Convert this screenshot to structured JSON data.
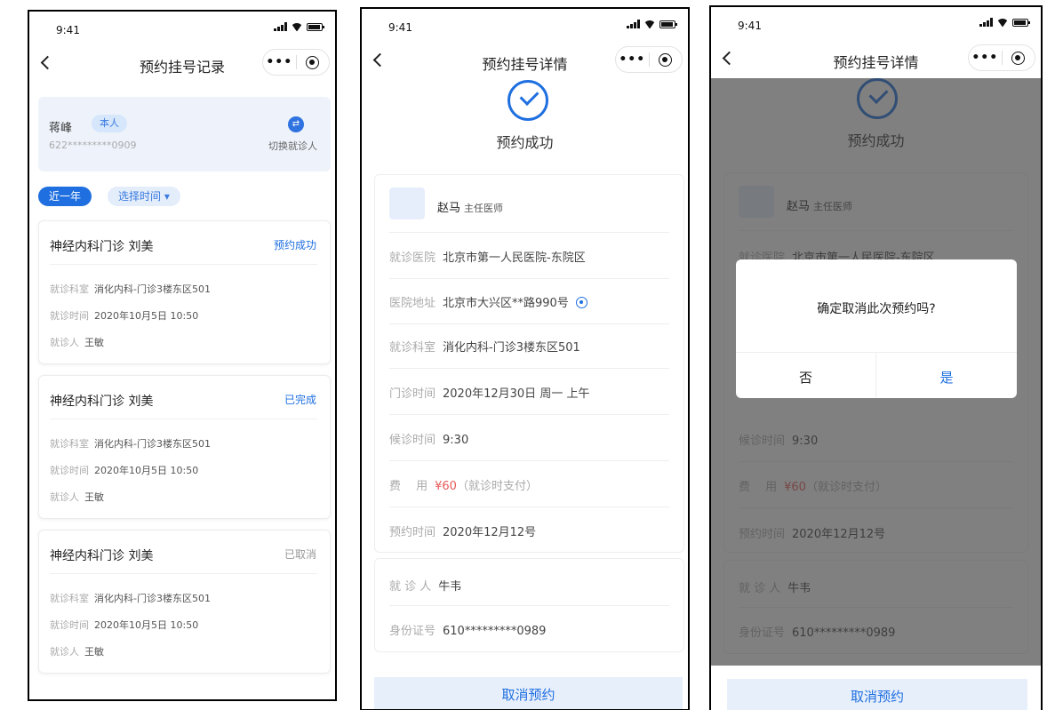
{
  "status_time": "9:41",
  "colors": {
    "primary": "#1f6fe0",
    "price": "#e85b5b",
    "done_gray": "#999999"
  },
  "records": {
    "title": "预约挂号记录",
    "patient": {
      "name": "蒋峰",
      "tag": "本人",
      "card": "622*********0909",
      "switch_label": "切换就诊人",
      "switch_icon": "swap-icon"
    },
    "filters": {
      "range": "近一年",
      "select_time": "选择时间 ▾"
    },
    "items": [
      {
        "title": "神经内科门诊 刘美",
        "status": "预约成功",
        "status_color": "#1f6fe0",
        "dept_label": "就诊科室",
        "dept": "消化内科-门诊3楼东区501",
        "time_label": "就诊时间",
        "time": "2020年10月5日 10:50",
        "person_label": "就诊人",
        "person": "王敏"
      },
      {
        "title": "神经内科门诊 刘美",
        "status": "已完成",
        "status_color": "#1f6fe0",
        "dept_label": "就诊科室",
        "dept": "消化内科-门诊3楼东区501",
        "time_label": "就诊时间",
        "time": "2020年10月5日 10:50",
        "person_label": "就诊人",
        "person": "王敏"
      },
      {
        "title": "神经内科门诊 刘美",
        "status": "已取消",
        "status_color": "#999999",
        "dept_label": "就诊科室",
        "dept": "消化内科-门诊3楼东区501",
        "time_label": "就诊时间",
        "time": "2020年10月5日 10:50",
        "person_label": "就诊人",
        "person": "王敏"
      }
    ]
  },
  "detail": {
    "title": "预约挂号详情",
    "success_text": "预约成功",
    "doctor": {
      "name": "赵马",
      "title": "主任医师"
    },
    "rows": [
      {
        "label": "就诊医院",
        "value": "北京市第一人民医院-东院区"
      },
      {
        "label": "医院地址",
        "value": "北京市大兴区**路990号"
      },
      {
        "label": "就诊科室",
        "value": "消化内科-门诊3楼东区501"
      },
      {
        "label": "门诊时间",
        "value": "2020年12月30日 周一 上午"
      },
      {
        "label": "候诊时间",
        "value": "9:30"
      },
      {
        "label": "费　 用",
        "value": "¥60",
        "suffix": "（就诊时支付）"
      },
      {
        "label": "预约时间",
        "value": "2020年12月12号"
      }
    ],
    "visitor": {
      "label": "就 诊 人",
      "name": "牛韦",
      "id_label": "身份证号",
      "id": "610*********0989"
    },
    "cancel_label": "取消预约"
  },
  "dialog": {
    "message": "确定取消此次预约吗?",
    "no": "否",
    "yes": "是"
  }
}
